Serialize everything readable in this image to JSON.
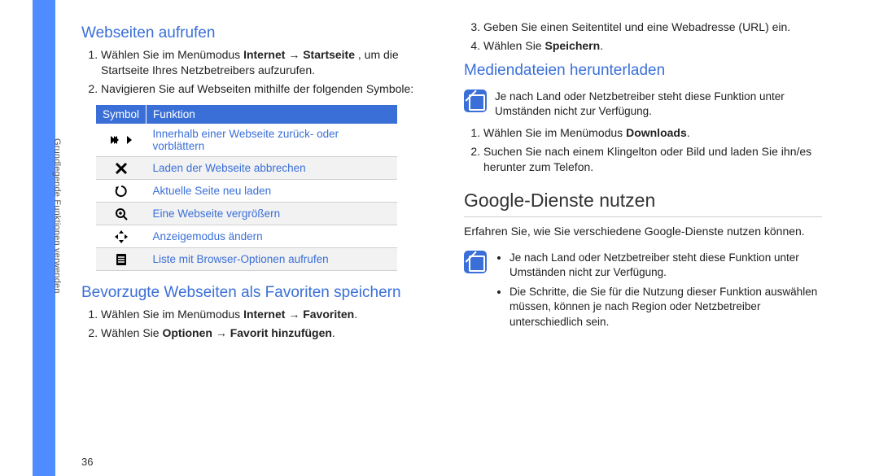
{
  "sidebar": {
    "running_head": "Grundlegende Funktionen verwenden"
  },
  "page_number": "36",
  "left": {
    "h_web_aufrufen": "Webseiten aufrufen",
    "step1a": "Wählen Sie im Menümodus ",
    "step1b": "Internet",
    "step1c": " → ",
    "step1d": "Startseite",
    "step1e": ", um die Startseite Ihres Netzbetreibers aufzurufen.",
    "step2": "Navigieren Sie auf Webseiten mithilfe der folgenden Symbole:",
    "h_favoriten": "Bevorzugte Webseiten als Favoriten speichern",
    "fav1a": "Wählen Sie im Menümodus ",
    "fav1b": "Internet",
    "fav1c": " → ",
    "fav1d": "Favoriten",
    "fav1e": ".",
    "fav2a": "Wählen Sie ",
    "fav2b": "Optionen",
    "fav2c": " → ",
    "fav2d": "Favorit hinzufügen",
    "fav2e": "."
  },
  "table": {
    "header": {
      "symbol": "Symbol",
      "funktion": "Funktion"
    },
    "rows": [
      {
        "fn": "Innerhalb einer Webseite zurück- oder vorblättern"
      },
      {
        "fn": "Laden der Webseite abbrechen"
      },
      {
        "fn": "Aktuelle Seite neu laden"
      },
      {
        "fn": "Eine Webseite vergrößern"
      },
      {
        "fn": "Anzeigemodus ändern"
      },
      {
        "fn": "Liste mit Browser-Optionen aufrufen"
      }
    ]
  },
  "right": {
    "step3": "Geben Sie einen Seitentitel und eine Webadresse (URL) ein.",
    "step4a": "Wählen Sie ",
    "step4b": "Speichern",
    "step4c": ".",
    "h_medien": "Mediendateien herunterladen",
    "note1": "Je nach Land oder Netzbetreiber steht diese Funktion unter Umständen nicht zur Verfügung.",
    "med1a": "Wählen Sie im Menümodus ",
    "med1b": "Downloads",
    "med1c": ".",
    "med2": "Suchen Sie nach einem Klingelton oder Bild und laden Sie ihn/es herunter zum Telefon.",
    "h_google": "Google-Dienste nutzen",
    "google_intro": "Erfahren Sie, wie Sie verschiedene Google-Dienste nutzen können.",
    "note2": [
      "Je nach Land oder Netzbetreiber steht diese Funktion unter Umständen nicht zur Verfügung.",
      "Die Schritte, die Sie für die Nutzung dieser Funktion auswählen müssen, können je nach Region oder Netzbetreiber unterschiedlich sein."
    ]
  }
}
